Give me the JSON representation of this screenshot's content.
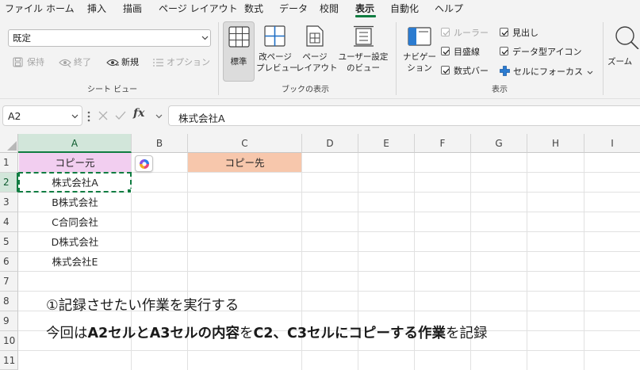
{
  "menu": {
    "tabs": [
      "ファイル",
      "ホーム",
      "挿入",
      "描画",
      "ページ レイアウト",
      "数式",
      "データ",
      "校閲",
      "表示",
      "自動化",
      "ヘルプ"
    ],
    "active_tab": "表示"
  },
  "ribbon": {
    "sheet_view": {
      "dropdown_value": "既定",
      "keep_label": "保持",
      "exit_label": "終了",
      "new_label": "新規",
      "options_label": "オプション",
      "group_label": "シート ビュー"
    },
    "workbook_views": {
      "normal_label": "標準",
      "page_break_label_1": "改ページ",
      "page_break_label_2": "プレビュー",
      "page_layout_label_1": "ページ",
      "page_layout_label_2": "レイアウト",
      "custom_views_label_1": "ユーザー設定",
      "custom_views_label_2": "のビュー",
      "group_label": "ブックの表示"
    },
    "show": {
      "navigation_label_1": "ナビゲー",
      "navigation_label_2": "ション",
      "ruler_label": "ルーラー",
      "gridlines_label": "目盛線",
      "formula_bar_label": "数式バー",
      "headings_label": "見出し",
      "data_type_icons_label": "データ型アイコン",
      "focus_cell_label": "セルにフォーカス",
      "group_label": "表示"
    },
    "zoom": {
      "label": "ズーム"
    }
  },
  "formula_bar": {
    "name_box": "A2",
    "fx_label": "fx",
    "content": "株式会社A"
  },
  "grid": {
    "columns": [
      "A",
      "B",
      "C",
      "D",
      "E",
      "F",
      "G",
      "H",
      "I"
    ],
    "rows": [
      "1",
      "2",
      "3",
      "4",
      "5",
      "6",
      "7",
      "8",
      "9",
      "10",
      "11"
    ],
    "selected_column": "A",
    "selected_row": "2",
    "cells": {
      "A1": "コピー元",
      "C1": "コピー先",
      "A2": "株式会社A",
      "A3": "B株式会社",
      "A4": "C合同会社",
      "A5": "D株式会社",
      "A6": "株式会社E"
    },
    "colors": {
      "A1_fill": "#f2cef0",
      "C1_fill": "#f7c7ac",
      "accent": "#107c41"
    }
  },
  "annotation": {
    "line1": "①記録させたい作業を実行する",
    "line2_parts": [
      "今回は",
      "A2セルとA3セルの内容",
      "を",
      "C2、C3セルにコピーする作業",
      "を記録"
    ]
  }
}
